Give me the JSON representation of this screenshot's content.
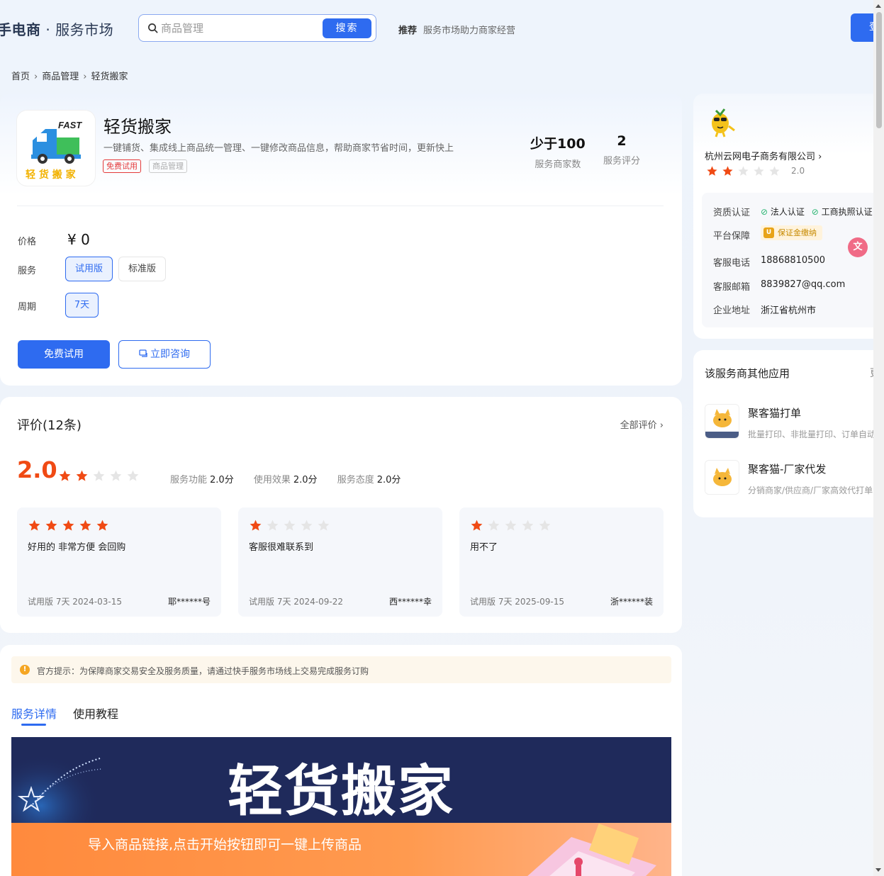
{
  "header": {
    "brand_main": "手电商",
    "brand_sub": " · 服务市场",
    "search_placeholder": "商品管理",
    "search_button": "搜索",
    "rec_label": "推荐",
    "rec_text": "服务市场助力商家经营",
    "login_label": "登"
  },
  "breadcrumb": [
    "首页",
    "商品管理",
    "轻货搬家"
  ],
  "product": {
    "logo_text": "FAST",
    "logo_caption": "轻 货 搬 家",
    "title": "轻货搬家",
    "desc": "一键铺货、集成线上商品统一管理、一键修改商品信息，帮助商家节省时间，更新快上",
    "tags": [
      "免费试用",
      "商品管理"
    ],
    "stats": [
      {
        "value": "少于100",
        "label": "服务商家数"
      },
      {
        "value": "2",
        "label": "服务评分"
      }
    ],
    "price_label": "价格",
    "price": "¥ 0",
    "service_label": "服务",
    "service_options": [
      "试用版",
      "标准版"
    ],
    "service_selected": "试用版",
    "period_label": "周期",
    "period_options": [
      "7天"
    ],
    "period_selected": "7天",
    "btn_trial": "免费试用",
    "btn_consult": "立即咨询"
  },
  "reviews": {
    "title": "评价(12条)",
    "all_link": "全部评价",
    "score": "2.0",
    "score_stars": 2,
    "sub_scores": [
      {
        "label": "服务功能",
        "value": "2.0分"
      },
      {
        "label": "使用效果",
        "value": "2.0分"
      },
      {
        "label": "服务态度",
        "value": "2.0分"
      }
    ],
    "items": [
      {
        "stars": 5,
        "text": "好用的 非常方便 会回购",
        "meta": "试用版 7天   2024-03-15",
        "user": "耶******号"
      },
      {
        "stars": 1,
        "text": "客服很难联系到",
        "meta": "试用版 7天   2024-09-22",
        "user": "西******幸"
      },
      {
        "stars": 1,
        "text": "用不了",
        "meta": "试用版 7天   2025-09-15",
        "user": "浙******装"
      }
    ]
  },
  "detail": {
    "notice": "官方提示：为保障商家交易安全及服务质量，请通过快手服务市场线上交易完成服务订购",
    "tabs": [
      "服务详情",
      "使用教程"
    ],
    "active_tab": "服务详情",
    "banner_title": "轻货搬家",
    "banner_sub": "导入商品链接,点击开始按钮即可一键上传商品"
  },
  "vendor": {
    "name": "杭州云网电子商务有限公司",
    "stars": 2,
    "rating": "2.0",
    "cert_label": "资质认证",
    "certs": [
      "法人认证",
      "工商执照认证"
    ],
    "guarantee_label": "平台保障",
    "guarantee": "保证金缴纳",
    "phone_label": "客服电话",
    "phone": "18868810500",
    "email_label": "客服邮箱",
    "email": "8839827@qq.com",
    "address_label": "企业地址",
    "address": "浙江省杭州市"
  },
  "other_apps": {
    "title": "该服务商其他应用",
    "more": "更",
    "items": [
      {
        "name": "聚客猫打单",
        "desc": "批量打印、非批量打印、订单自动"
      },
      {
        "name": "聚客猫-厂家代发",
        "desc": "分销商家/供应商/厂家高效代打单"
      }
    ]
  },
  "colors": {
    "accent": "#2e6bf0",
    "star": "#f04a14",
    "star_empty": "#e5e5e5",
    "banner": "#1f2a5b"
  }
}
